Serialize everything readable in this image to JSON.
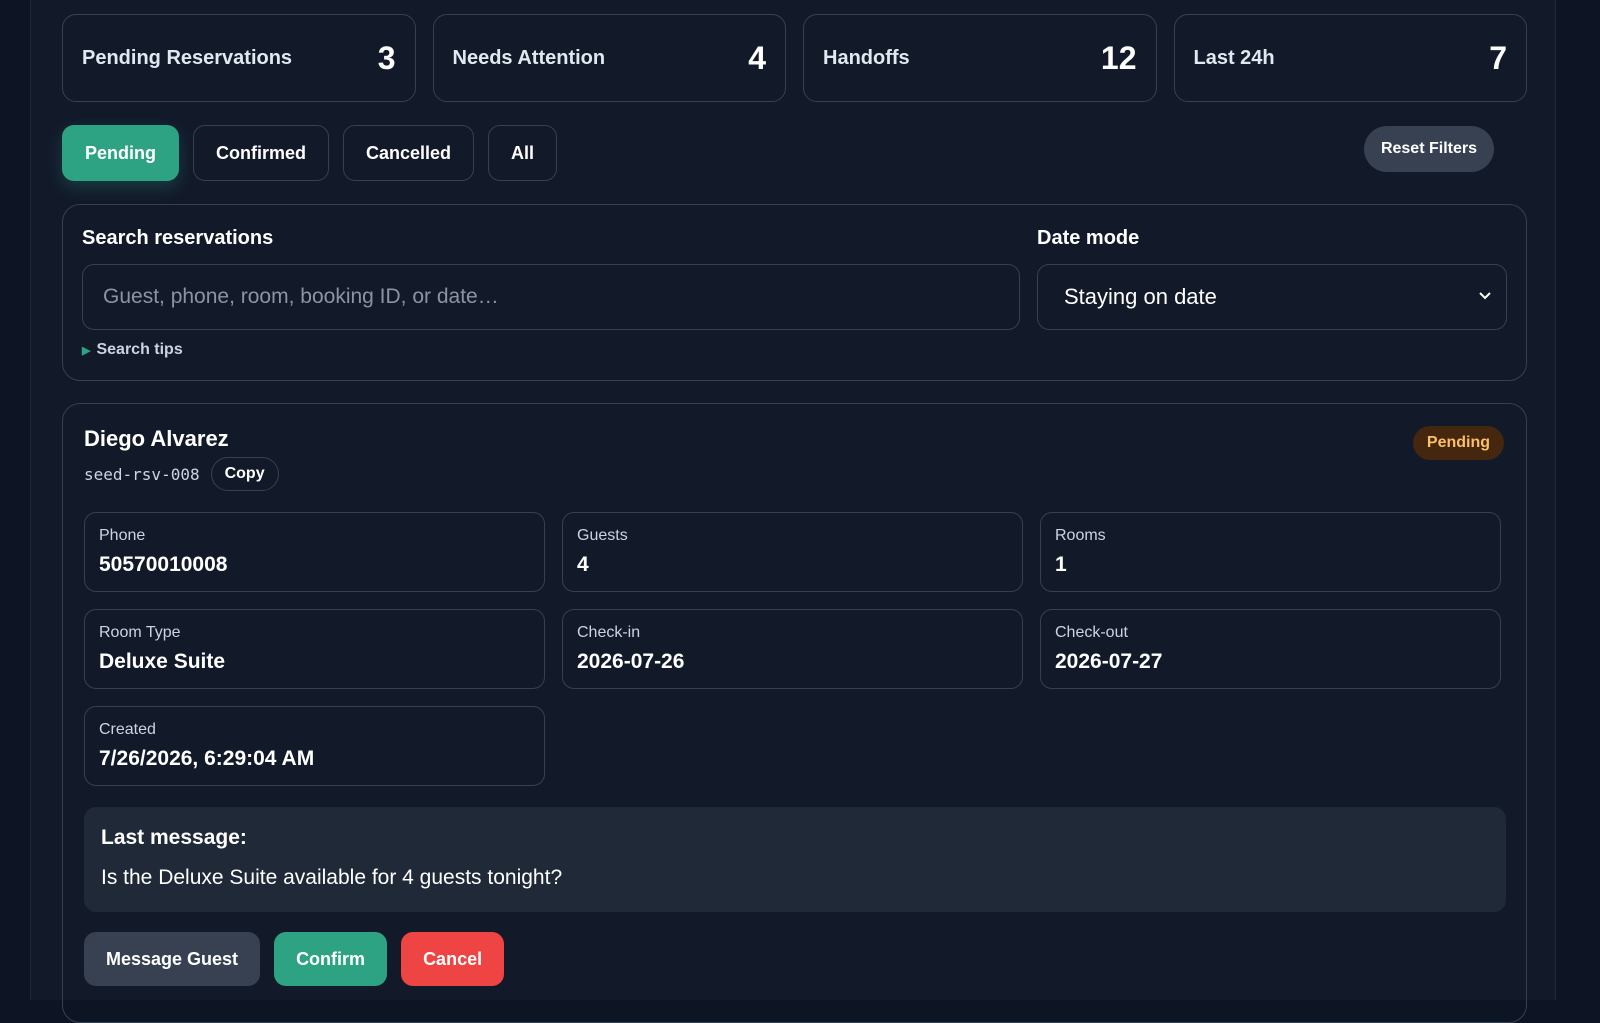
{
  "stats": [
    {
      "label": "Pending Reservations",
      "value": "3"
    },
    {
      "label": "Needs Attention",
      "value": "4"
    },
    {
      "label": "Handoffs",
      "value": "12"
    },
    {
      "label": "Last 24h",
      "value": "7"
    }
  ],
  "filters": {
    "tabs": [
      {
        "label": "Pending",
        "active": true
      },
      {
        "label": "Confirmed",
        "active": false
      },
      {
        "label": "Cancelled",
        "active": false
      },
      {
        "label": "All",
        "active": false
      }
    ],
    "reset_label": "Reset Filters"
  },
  "search": {
    "label": "Search reservations",
    "placeholder": "Guest, phone, room, booking ID, or date…",
    "value": "",
    "date_mode_label": "Date mode",
    "date_mode_selected": "Staying on date",
    "tips_label": "Search tips"
  },
  "reservation": {
    "guest_name": "Diego Alvarez",
    "booking_id": "seed-rsv-008",
    "copy_label": "Copy",
    "status": "Pending",
    "fields": [
      {
        "label": "Phone",
        "value": "50570010008"
      },
      {
        "label": "Guests",
        "value": "4"
      },
      {
        "label": "Rooms",
        "value": "1"
      },
      {
        "label": "Room Type",
        "value": "Deluxe Suite"
      },
      {
        "label": "Check-in",
        "value": "2026-07-26"
      },
      {
        "label": "Check-out",
        "value": "2026-07-27"
      },
      {
        "label": "Created",
        "value": "7/26/2026, 6:29:04 AM"
      }
    ],
    "last_message_title": "Last message:",
    "last_message_text": "Is the Deluxe Suite available for 4 guests tonight?",
    "actions": {
      "message": "Message Guest",
      "confirm": "Confirm",
      "cancel": "Cancel"
    }
  },
  "colors": {
    "background": "#121a2a",
    "accent": "#2ea383",
    "danger": "#ef4444",
    "pending_badge_bg": "#45260f",
    "pending_badge_text": "#fbbf66"
  },
  "icons": {
    "select": "chevron-down-icon",
    "tips": "triangle-right-icon"
  }
}
